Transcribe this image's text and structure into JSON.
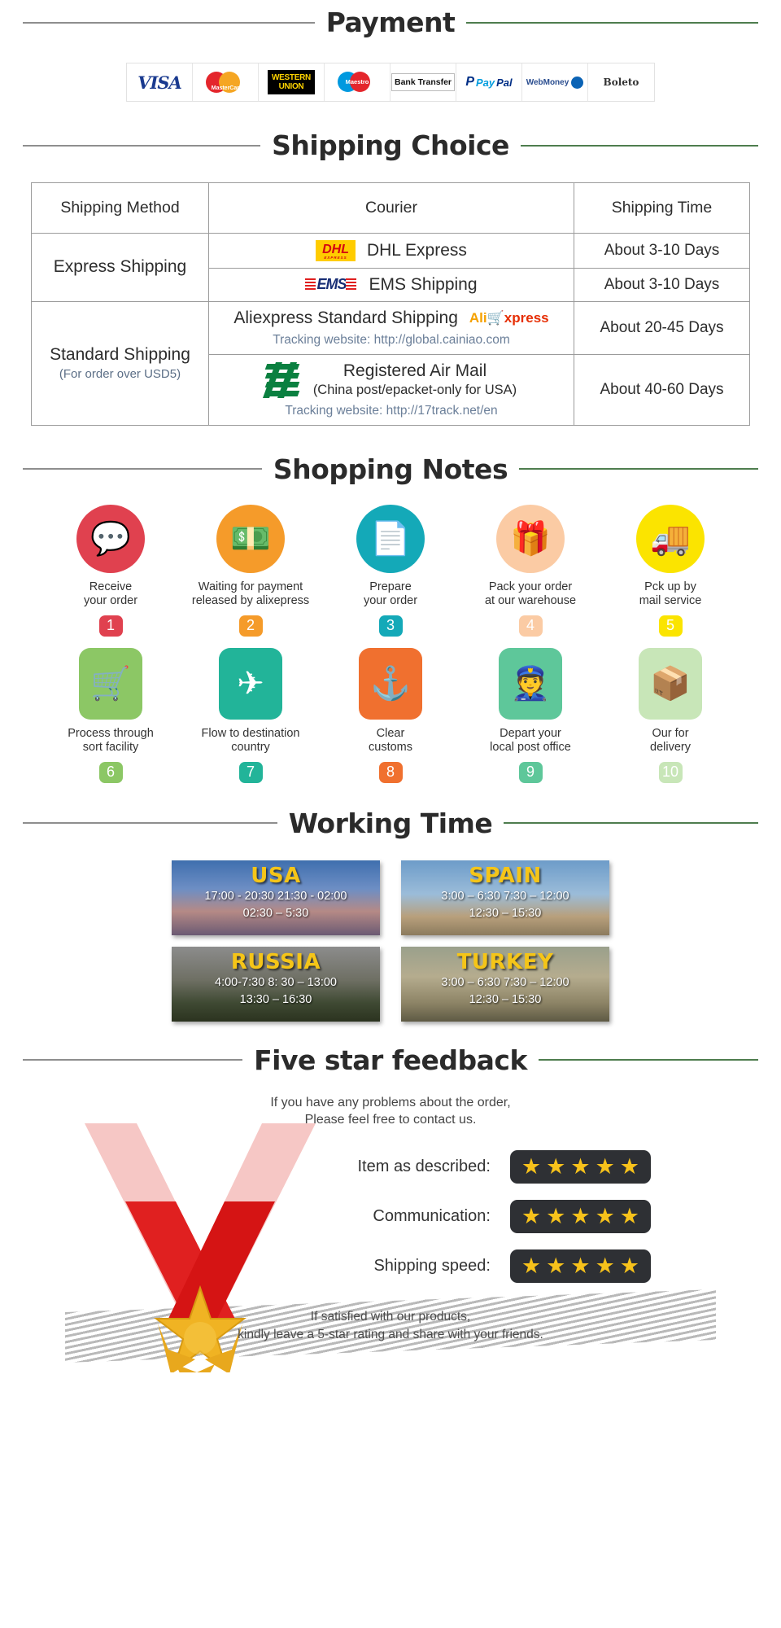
{
  "sections": {
    "payment": "Payment",
    "shipping": "Shipping Choice",
    "notes": "Shopping Notes",
    "working": "Working Time",
    "feedback": "Five star feedback"
  },
  "payment_methods": [
    {
      "name": "visa",
      "label": "VISA"
    },
    {
      "name": "mastercard",
      "label": "MasterCard"
    },
    {
      "name": "western-union",
      "label": "WESTERN UNION"
    },
    {
      "name": "maestro",
      "label": "Maestro"
    },
    {
      "name": "bank-transfer",
      "label": "Bank Transfer"
    },
    {
      "name": "paypal",
      "label": "PayPal"
    },
    {
      "name": "webmoney",
      "label": "WebMoney"
    },
    {
      "name": "boleto",
      "label": "Boleto"
    }
  ],
  "shipping_table": {
    "headers": [
      "Shipping Method",
      "Courier",
      "Shipping Time"
    ],
    "rows": [
      {
        "method": "Express Shipping",
        "method_sub": "",
        "courier": "DHL Express",
        "courier_logo": "DHL",
        "time": "About 3-10 Days",
        "tracking": ""
      },
      {
        "method": "",
        "method_sub": "",
        "courier": "EMS Shipping",
        "courier_logo": "EMS",
        "time": "About 3-10 Days",
        "tracking": ""
      },
      {
        "method": "Standard Shipping",
        "method_sub": "(For order over USD5)",
        "courier": "Aliexpress Standard Shipping",
        "courier_logo": "AliExpress",
        "time": "About 20-45 Days",
        "tracking": "Tracking website: http://global.cainiao.com"
      },
      {
        "method": "",
        "method_sub": "",
        "courier": "Registered Air Mail",
        "courier_sub": "(China post/epacket-only for USA)",
        "courier_logo": "China Post",
        "time": "About 40-60 Days",
        "tracking": "Tracking website: http://17track.net/en"
      }
    ]
  },
  "shopping_notes": [
    {
      "num": "1",
      "label": "Receive\nyour order",
      "icon": "laptop-chat-icon",
      "color": "#e0414f",
      "shape": "circle",
      "glyph": "💬"
    },
    {
      "num": "2",
      "label": "Waiting for payment\nreleased by alixepress",
      "icon": "hand-money-icon",
      "color": "#f59b2a",
      "shape": "circle",
      "glyph": "💵"
    },
    {
      "num": "3",
      "label": "Prepare\nyour order",
      "icon": "documents-icon",
      "color": "#14a9b8",
      "shape": "circle",
      "glyph": "📄"
    },
    {
      "num": "4",
      "label": "Pack your order\nat our warehouse",
      "icon": "gift-box-icon",
      "color": "#fbcba4",
      "shape": "circle",
      "glyph": "🎁"
    },
    {
      "num": "5",
      "label": "Pck up by\nmail service",
      "icon": "truck-icon",
      "color": "#fbe400",
      "shape": "circle",
      "glyph": "🚚"
    },
    {
      "num": "6",
      "label": "Process through\nsort facility",
      "icon": "shopping-cart-icon",
      "color": "#8cc765",
      "shape": "rounded",
      "glyph": "🛒"
    },
    {
      "num": "7",
      "label": "Flow to destination\ncountry",
      "icon": "airplane-icon",
      "color": "#22b499",
      "shape": "rounded",
      "glyph": "✈"
    },
    {
      "num": "8",
      "label": "Clear\ncustoms",
      "icon": "anchor-icon",
      "color": "#f0702f",
      "shape": "rounded",
      "glyph": "⚓"
    },
    {
      "num": "9",
      "label": "Depart your\nlocal post office",
      "icon": "postman-icon",
      "color": "#5ec79a",
      "shape": "rounded",
      "glyph": "👮"
    },
    {
      "num": "10",
      "label": "Our for\ndelivery",
      "icon": "parcel-icon",
      "color": "#c8e6b8",
      "shape": "rounded",
      "glyph": "📦"
    }
  ],
  "working_time": [
    {
      "country": "USA",
      "line1": "17:00 - 20:30  21:30 - 02:00",
      "line2": "02:30 – 5:30",
      "bg": "bg-usa"
    },
    {
      "country": "SPAIN",
      "line1": "3:00 –  6:30   7:30 – 12:00",
      "line2": "12:30 – 15:30",
      "bg": "bg-spain"
    },
    {
      "country": "RUSSIA",
      "line1": "4:00-7:30  8: 30 – 13:00",
      "line2": "13:30 – 16:30",
      "bg": "bg-russia"
    },
    {
      "country": "TURKEY",
      "line1": "3:00 –  6:30   7:30 – 12:00",
      "line2": "12:30 – 15:30",
      "bg": "bg-turkey"
    }
  ],
  "feedback": {
    "subtitle_line1": "If you have any problems about the order,",
    "subtitle_line2": "Please feel free to contact us.",
    "ratings": [
      {
        "label": "Item as described:",
        "stars": 5
      },
      {
        "label": "Communication:",
        "stars": 5
      },
      {
        "label": "Shipping speed:",
        "stars": 5
      }
    ],
    "footer_line1": "If satisfied with our products,",
    "footer_line2": "kindly leave a 5-star rating and share with your friends.",
    "star_glyph": "★"
  },
  "colors": {
    "rule_left": "#8e8e8e",
    "rule_right": "#4e7d4e",
    "star": "#f7c21b",
    "star_bg": "#2e3034"
  }
}
